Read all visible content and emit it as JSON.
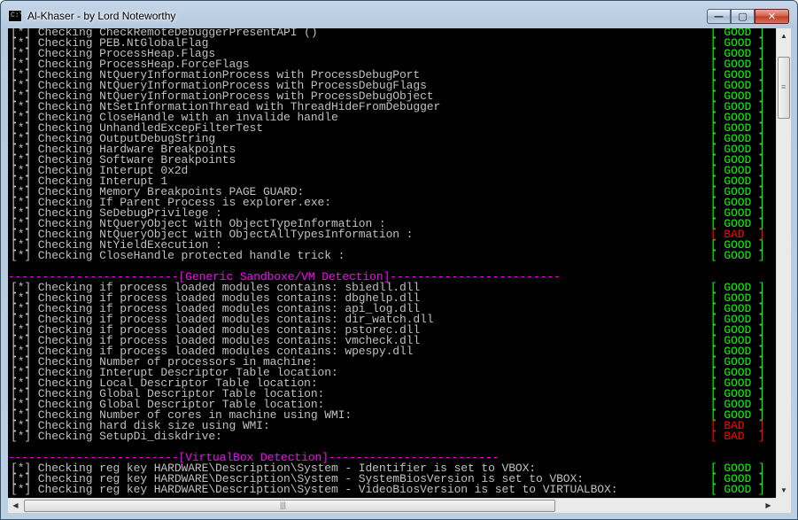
{
  "window": {
    "title": "Al-Khaser - by Lord Noteworthy",
    "icon_text": "C:\\",
    "min_glyph": "—",
    "max_glyph": "▢",
    "close_glyph": "✕"
  },
  "colors": {
    "good": "#00ff00",
    "bad": "#ff0000",
    "header": "#ff00ff",
    "text": "#c0c0c0",
    "console_bg": "#000000"
  },
  "status": {
    "good": "[ GOOD ]",
    "bad": "[ BAD  ]"
  },
  "lines": [
    {
      "text": "[*] Checking CheckRemoteDebuggerPresentAPI ()",
      "status": "good"
    },
    {
      "text": "[*] Checking PEB.NtGlobalFlag",
      "status": "good"
    },
    {
      "text": "[*] Checking ProcessHeap.Flags",
      "status": "good"
    },
    {
      "text": "[*] Checking ProcessHeap.ForceFlags",
      "status": "good"
    },
    {
      "text": "[*] Checking NtQueryInformationProcess with ProcessDebugPort",
      "status": "good"
    },
    {
      "text": "[*] Checking NtQueryInformationProcess with ProcessDebugFlags",
      "status": "good"
    },
    {
      "text": "[*] Checking NtQueryInformationProcess with ProcessDebugObject",
      "status": "good"
    },
    {
      "text": "[*] Checking NtSetInformationThread with ThreadHideFromDebugger",
      "status": "good"
    },
    {
      "text": "[*] Checking CloseHandle with an invalide handle",
      "status": "good"
    },
    {
      "text": "[*] Checking UnhandledExcepFilterTest",
      "status": "good"
    },
    {
      "text": "[*] Checking OutputDebugString",
      "status": "good"
    },
    {
      "text": "[*] Checking Hardware Breakpoints",
      "status": "good"
    },
    {
      "text": "[*] Checking Software Breakpoints",
      "status": "good"
    },
    {
      "text": "[*] Checking Interupt 0x2d",
      "status": "good"
    },
    {
      "text": "[*] Checking Interupt 1",
      "status": "good"
    },
    {
      "text": "[*] Checking Memory Breakpoints PAGE GUARD:",
      "status": "good"
    },
    {
      "text": "[*] Checking If Parent Process is explorer.exe:",
      "status": "good"
    },
    {
      "text": "[*] Checking SeDebugPrivilege :",
      "status": "good"
    },
    {
      "text": "[*] Checking NtQueryObject with ObjectTypeInformation :",
      "status": "good"
    },
    {
      "text": "[*] Checking NtQueryObject with ObjectAllTypesInformation :",
      "status": "bad"
    },
    {
      "text": "[*] Checking NtYieldExecution :",
      "status": "good"
    },
    {
      "text": "[*] Checking CloseHandle protected handle trick :",
      "status": "good"
    },
    {
      "text": "",
      "status": ""
    },
    {
      "text": "-------------------------[Generic Sandboxe/VM Detection]-------------------------",
      "status": "",
      "header": true
    },
    {
      "text": "[*] Checking if process loaded modules contains: sbiedll.dll",
      "status": "good"
    },
    {
      "text": "[*] Checking if process loaded modules contains: dbghelp.dll",
      "status": "good"
    },
    {
      "text": "[*] Checking if process loaded modules contains: api_log.dll",
      "status": "good"
    },
    {
      "text": "[*] Checking if process loaded modules contains: dir_watch.dll",
      "status": "good"
    },
    {
      "text": "[*] Checking if process loaded modules contains: pstorec.dll",
      "status": "good"
    },
    {
      "text": "[*] Checking if process loaded modules contains: vmcheck.dll",
      "status": "good"
    },
    {
      "text": "[*] Checking if process loaded modules contains: wpespy.dll",
      "status": "good"
    },
    {
      "text": "[*] Checking Number of processors in machine:",
      "status": "good"
    },
    {
      "text": "[*] Checking Interupt Descriptor Table location:",
      "status": "good"
    },
    {
      "text": "[*] Checking Local Descriptor Table location:",
      "status": "good"
    },
    {
      "text": "[*] Checking Global Descriptor Table location:",
      "status": "good"
    },
    {
      "text": "[*] Checking Global Descriptor Table location:",
      "status": "good"
    },
    {
      "text": "[*] Checking Number of cores in machine using WMI:",
      "status": "good"
    },
    {
      "text": "[*] Checking hard disk size using WMI:",
      "status": "bad"
    },
    {
      "text": "[*] Checking SetupDi_diskdrive:",
      "status": "bad"
    },
    {
      "text": "",
      "status": ""
    },
    {
      "text": "-------------------------[VirtualBox Detection]-------------------------",
      "status": "",
      "header": true
    },
    {
      "text": "[*] Checking reg key HARDWARE\\Description\\System - Identifier is set to VBOX:",
      "status": "good"
    },
    {
      "text": "[*] Checking reg key HARDWARE\\Description\\System - SystemBiosVersion is set to VBOX:",
      "status": "good"
    },
    {
      "text": "[*] Checking reg key HARDWARE\\Description\\System - VideoBiosVersion is set to VIRTUALBOX:",
      "status": "good"
    }
  ],
  "scrollbar": {
    "up": "▲",
    "down": "▼",
    "left": "◀",
    "right": "▶",
    "vgrip": "≡",
    "hgrip": "|||"
  }
}
